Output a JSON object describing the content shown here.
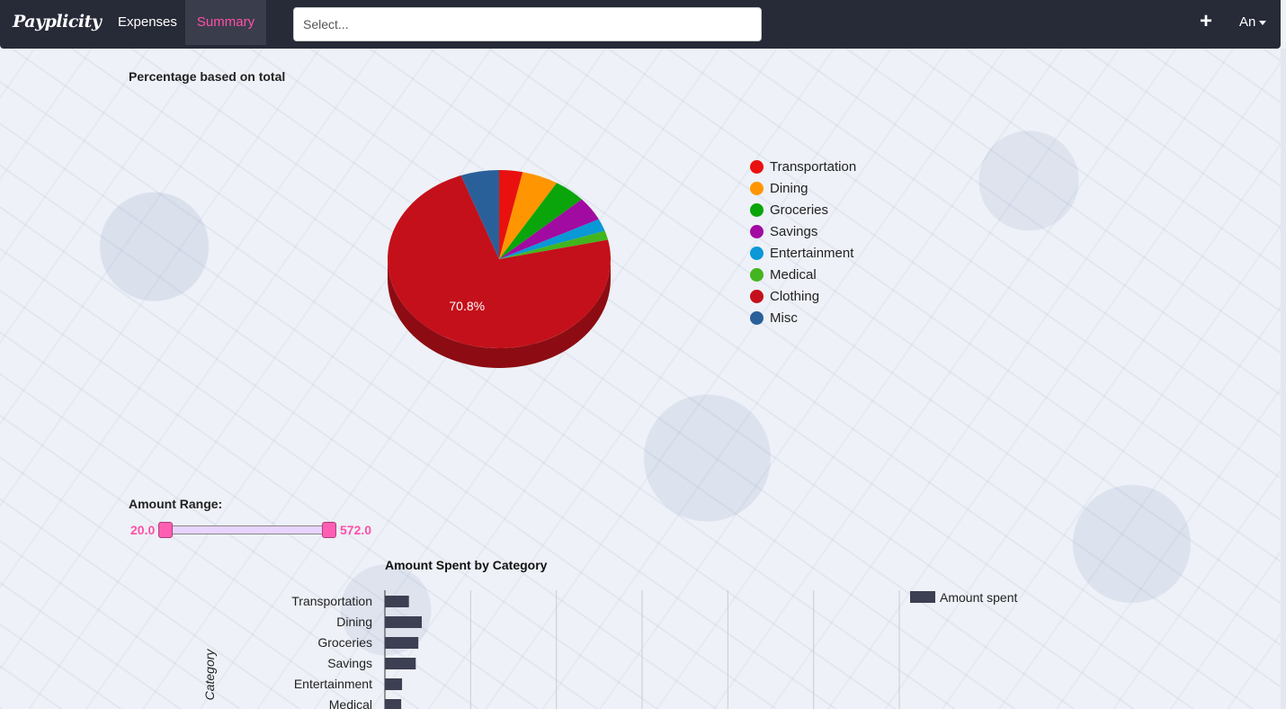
{
  "navbar": {
    "brand": "Payplicity",
    "links": [
      "Expenses",
      "Summary"
    ],
    "active": "Summary",
    "search_placeholder": "Select...",
    "add_icon": "plus-icon",
    "user": "An"
  },
  "pie_section": {
    "title": "Percentage based on total"
  },
  "chart_data": [
    {
      "type": "pie",
      "title": "Percentage based on total",
      "categories": [
        "Transportation",
        "Dining",
        "Groceries",
        "Savings",
        "Entertainment",
        "Medical",
        "Clothing",
        "Misc"
      ],
      "values": [
        3.3,
        5.1,
        4.5,
        4.2,
        2.2,
        1.6,
        70.8,
        5.4
      ],
      "colors": [
        "#e8110f",
        "#ff9501",
        "#0aa50a",
        "#a10ba1",
        "#0a98d6",
        "#43b51e",
        "#c4101a",
        "#2a6099"
      ],
      "labels_shown": [
        "70.8%"
      ],
      "legend": "right"
    },
    {
      "type": "bar",
      "title": "Amount Spent by Category",
      "ylabel": "Category",
      "categories": [
        "Transportation",
        "Dining",
        "Groceries",
        "Savings",
        "Entertainment",
        "Medical"
      ],
      "series": [
        {
          "name": "Amount spent",
          "values": [
            28,
            43,
            39,
            36,
            20,
            19
          ]
        }
      ],
      "xlim": [
        0,
        600
      ],
      "grid": true,
      "legend": "top-right",
      "color": "#3d3f52"
    }
  ],
  "range": {
    "title": "Amount Range:",
    "min_label": "20.0",
    "max_label": "572.0",
    "min": 20.0,
    "max": 572.0
  }
}
